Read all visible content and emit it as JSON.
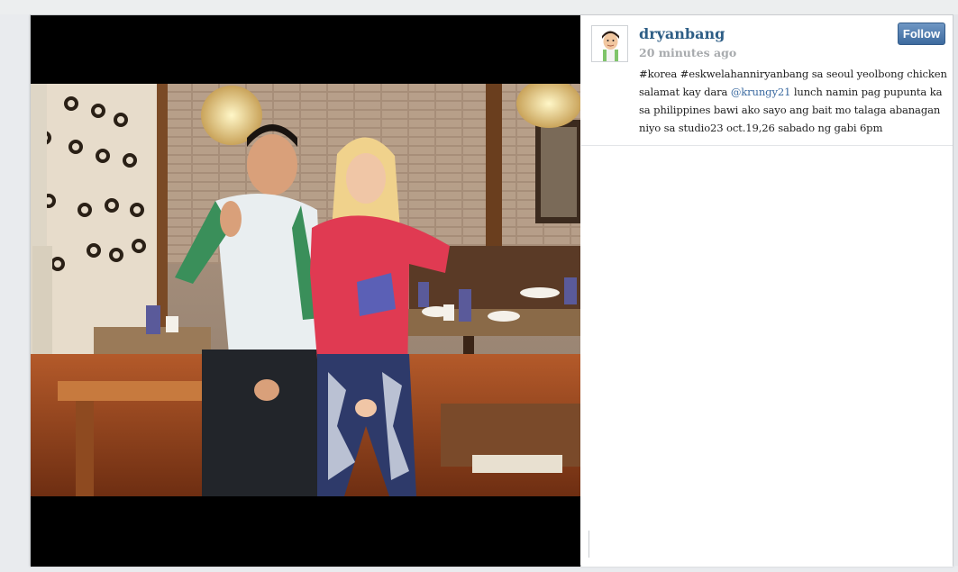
{
  "post": {
    "username": "dryanbang",
    "timestamp": "20 minutes ago",
    "follow_label": "Follow",
    "caption_lines": [
      "#korea #eskwelahanniryanbang sa seoul yeolbong chicken",
      "salamat kay dara ",
      "@krungy21",
      " lunch namin pag pupunta ka",
      "sa philippines bawi ako sayo ang bait mo talaga abanagan",
      "niyo sa studio23 oct.19,26 sabado ng gabi 6pm"
    ],
    "photo_alt": "Photo of two people making peace signs while seated at a restaurant table"
  },
  "colors": {
    "username": "#2e5e86",
    "mention": "#3b6aa0",
    "follow_button": "#4a76a8",
    "timestamp": "#a7aaad"
  },
  "icons": {
    "avatar": "avatar-cartoon-icon"
  }
}
